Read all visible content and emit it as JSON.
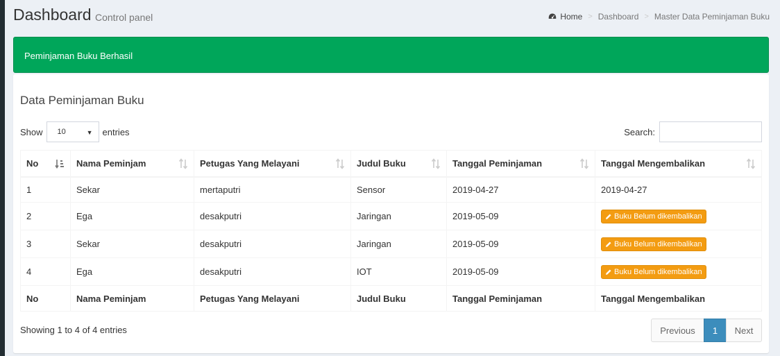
{
  "header": {
    "title": "Dashboard",
    "subtitle": "Control panel",
    "breadcrumb": [
      {
        "label": "Home",
        "icon": "dashboard-icon"
      },
      {
        "label": "Dashboard"
      },
      {
        "label": "Master Data Peminjaman Buku"
      }
    ]
  },
  "alert": {
    "message": "Peminjaman Buku Berhasil",
    "color": "#00a65a"
  },
  "box": {
    "title": "Data Peminjaman Buku",
    "length": {
      "show_label": "Show",
      "value": "10",
      "entries_label": "entries"
    },
    "search": {
      "label": "Search:",
      "value": "",
      "placeholder": ""
    }
  },
  "table": {
    "columns": [
      "No",
      "Nama Peminjam",
      "Petugas Yang Melayani",
      "Judul Buku",
      "Tanggal Peminjaman",
      "Tanggal Mengembalikan"
    ],
    "rows": [
      {
        "no": "1",
        "nama": "Sekar",
        "petugas": "mertaputri",
        "judul": "Sensor",
        "tgl_pinjam": "2019-04-27",
        "tgl_kembali": "2019-04-27",
        "is_button": false
      },
      {
        "no": "2",
        "nama": "Ega",
        "petugas": "desakputri",
        "judul": "Jaringan",
        "tgl_pinjam": "2019-05-09",
        "tgl_kembali": "Buku Belum dikembalikan",
        "is_button": true
      },
      {
        "no": "3",
        "nama": "Sekar",
        "petugas": "desakputri",
        "judul": "Jaringan",
        "tgl_pinjam": "2019-05-09",
        "tgl_kembali": "Buku Belum dikembalikan",
        "is_button": true
      },
      {
        "no": "4",
        "nama": "Ega",
        "petugas": "desakputri",
        "judul": "IOT",
        "tgl_pinjam": "2019-05-09",
        "tgl_kembali": "Buku Belum dikembalikan",
        "is_button": true
      }
    ]
  },
  "footer": {
    "info": "Showing 1 to 4 of 4 entries",
    "pagination": {
      "previous": "Previous",
      "current": "1",
      "next": "Next"
    }
  },
  "colors": {
    "success": "#00a65a",
    "warning": "#f39c12",
    "primary": "#3c8dbc"
  }
}
